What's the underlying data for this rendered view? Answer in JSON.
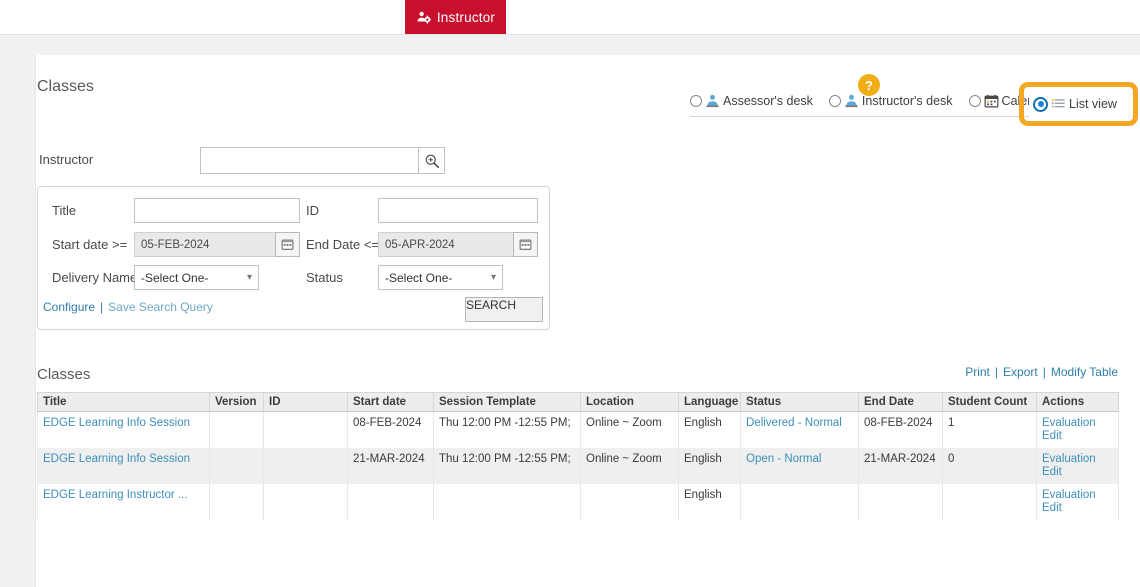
{
  "topbar": {
    "tab_label": "Instructor",
    "tab_icon": "instructor-person-gear-icon",
    "tab_color": "#c8102e"
  },
  "page": {
    "classes_heading": "Classes",
    "table_heading": "Classes"
  },
  "view_switcher": {
    "help_badge": "?",
    "options": [
      {
        "label": "Assessor's desk",
        "icon": "assessor-desk-icon",
        "selected": false
      },
      {
        "label": "Instructor's desk",
        "icon": "instructor-desk-icon",
        "selected": false
      },
      {
        "label": "Calendar view",
        "icon": "calendar-icon",
        "selected": false
      },
      {
        "label": "List view",
        "icon": "list-icon",
        "selected": true
      }
    ],
    "highlight_color": "#f5a623"
  },
  "instructor_search": {
    "label": "Instructor",
    "value": "",
    "placeholder": "",
    "search_icon": "magnifier-plus-icon"
  },
  "search_form": {
    "title_label": "Title",
    "title_value": "",
    "id_label": "ID",
    "id_value": "",
    "start_date_label": "Start date >=",
    "start_date_value": "05-FEB-2024",
    "end_date_label": "End Date <=",
    "end_date_value": "05-APR-2024",
    "delivery_name_label": "Delivery Name",
    "delivery_name_value": "-Select One-",
    "status_label": "Status",
    "status_value": "-Select One-",
    "configure_link": "Configure",
    "separator": "|",
    "save_search_link": "Save Search Query",
    "search_button": "SEARCH"
  },
  "table_tools": {
    "print": "Print",
    "sep1": "|",
    "export": "Export",
    "sep2": "|",
    "modify": "Modify Table"
  },
  "table": {
    "columns": [
      "Title",
      "Version",
      "ID",
      "Start date",
      "Session Template",
      "Location",
      "Language",
      "Status",
      "End Date",
      "Student Count",
      "Actions"
    ],
    "rows": [
      {
        "title": "EDGE Learning Info Session",
        "version": "",
        "id": "",
        "start_date": "08-FEB-2024",
        "session_template": "Thu 12:00 PM -12:55 PM;",
        "location": "Online ~ Zoom",
        "language": "English",
        "status": "Delivered - Normal",
        "end_date": "08-FEB-2024",
        "student_count": "1",
        "action_evaluation": "Evaluation",
        "action_edit": "Edit"
      },
      {
        "title": "EDGE Learning Info Session",
        "version": "",
        "id": "",
        "start_date": "21-MAR-2024",
        "session_template": "Thu 12:00 PM -12:55 PM;",
        "location": "Online ~ Zoom",
        "language": "English",
        "status": "Open - Normal",
        "end_date": "21-MAR-2024",
        "student_count": "0",
        "action_evaluation": "Evaluation",
        "action_edit": "Edit"
      },
      {
        "title": "EDGE Learning Instructor ...",
        "version": "",
        "id": "",
        "start_date": "",
        "session_template": "",
        "location": "",
        "language": "English",
        "status": "",
        "end_date": "",
        "student_count": "",
        "action_evaluation": "Evaluation",
        "action_edit": "Edit"
      }
    ]
  }
}
